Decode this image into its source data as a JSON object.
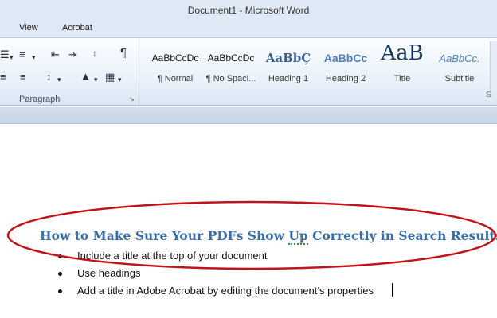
{
  "window": {
    "title": "Document1  -  Microsoft Word"
  },
  "tabs": [
    "View",
    "Acrobat"
  ],
  "paragraph_group": {
    "label": "Paragraph"
  },
  "styles_gallery": [
    {
      "preview": "AaBbCcDc",
      "name": "¶ Normal"
    },
    {
      "preview": "AaBbCcDc",
      "name": "¶ No Spaci..."
    },
    {
      "preview": "AaBbÇ",
      "name": "Heading 1"
    },
    {
      "preview": "AaBbCc",
      "name": "Heading 2"
    },
    {
      "preview": "AaB",
      "name": "Title"
    },
    {
      "preview": "AaBbCc.",
      "name": "Subtitle"
    }
  ],
  "styles_group": {
    "label": "S"
  },
  "document": {
    "heading_parts": [
      "How to Make Sure Your PDFs Show ",
      "Up",
      " Correctly in Search Results"
    ],
    "bullets": [
      "Include a title  at the top of your document",
      "Use headings",
      "Add a title in Adobe Acrobat by editing the document’s properties"
    ]
  },
  "colors": {
    "heading": "#3a6ea8",
    "annotation_ellipse": "#c0161b",
    "ribbon": "#dfe9f5"
  }
}
